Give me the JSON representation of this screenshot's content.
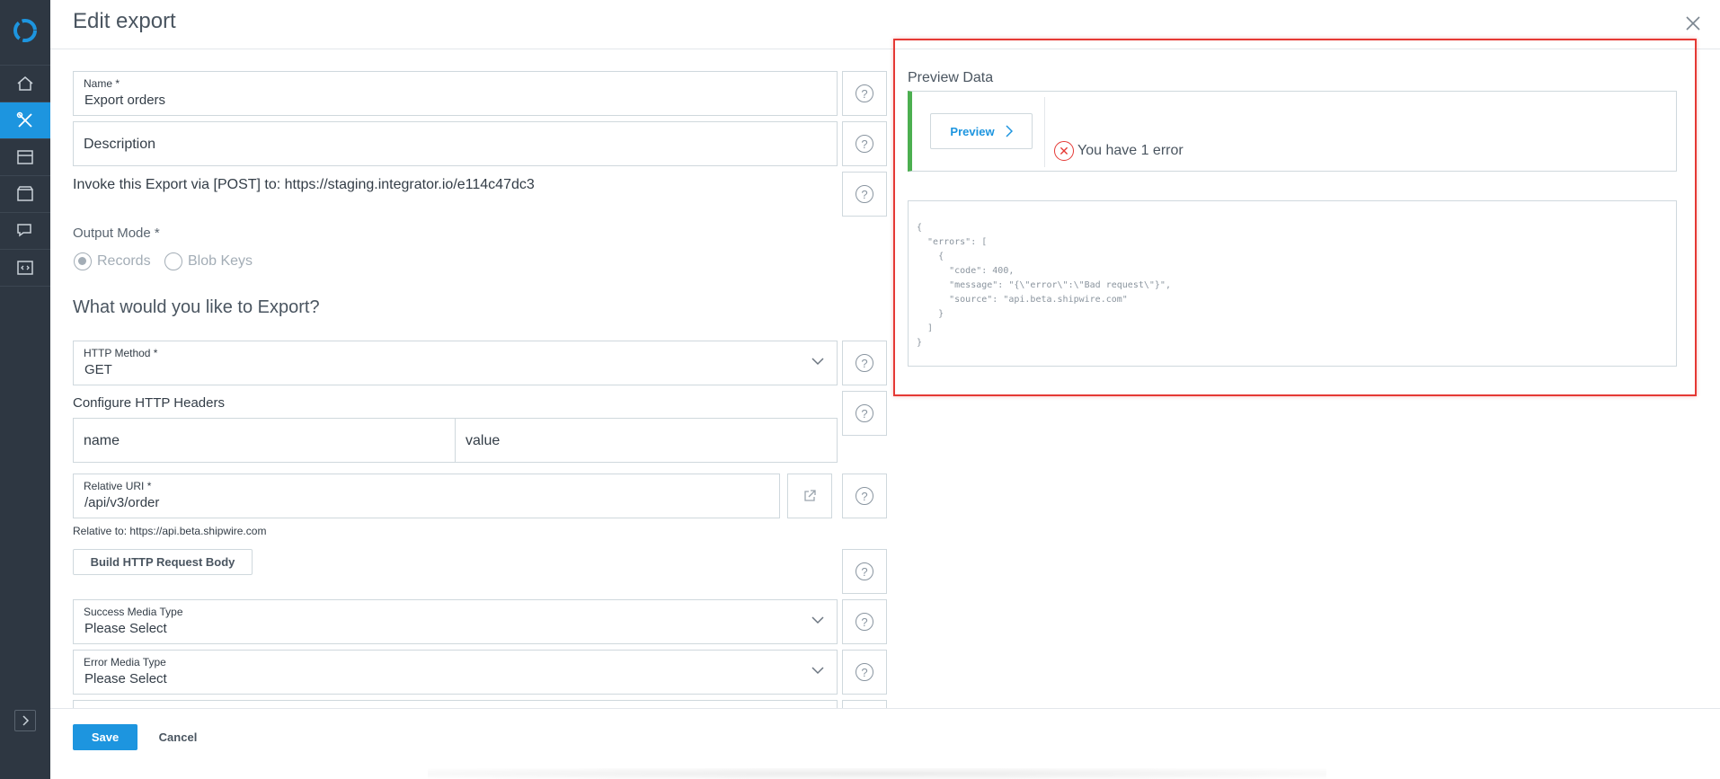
{
  "page": {
    "title": "Edit export"
  },
  "form": {
    "name": {
      "label": "Name *",
      "value": "Export orders"
    },
    "description": {
      "placeholder": "Description"
    },
    "invoke_text": "Invoke this Export via [POST] to: https://staging.integrator.io/e114c47dc3",
    "output_mode": {
      "label": "Output Mode *",
      "options": [
        "Records",
        "Blob Keys"
      ],
      "selected": "Records"
    },
    "section_heading": "What would you like to Export?",
    "http_method": {
      "label": "HTTP Method *",
      "value": "GET"
    },
    "headers": {
      "label": "Configure HTTP Headers",
      "name_placeholder": "name",
      "value_placeholder": "value"
    },
    "relative_uri": {
      "label": "Relative URI *",
      "value": "/api/v3/order",
      "relative_to": "Relative to: https://api.beta.shipwire.com"
    },
    "build_body_label": "Build HTTP Request Body",
    "success_media": {
      "label": "Success Media Type",
      "value": "Please Select"
    },
    "error_media": {
      "label": "Error Media Type",
      "value": "Please Select"
    },
    "help_glyph": "?"
  },
  "footer": {
    "save_label": "Save",
    "cancel_label": "Cancel"
  },
  "preview": {
    "title": "Preview Data",
    "button_label": "Preview",
    "error_text": "You have 1 error",
    "response": "{\n  \"errors\": [\n    {\n      \"code\": 400,\n      \"message\": \"{\\\"error\\\":\\\"Bad request\\\"}\",\n      \"source\": \"api.beta.shipwire.com\"\n    }\n  ]\n}"
  },
  "sidebar": {
    "items": [
      "home-icon",
      "tools-icon",
      "archive-icon",
      "marketplace-icon",
      "chat-icon",
      "code-icon"
    ],
    "active": "tools-icon"
  },
  "colors": {
    "accent": "#1d95df",
    "sidebar": "#2e3742",
    "success_bar": "#4caf50",
    "error": "#e53935",
    "highlight": "#e53935"
  }
}
